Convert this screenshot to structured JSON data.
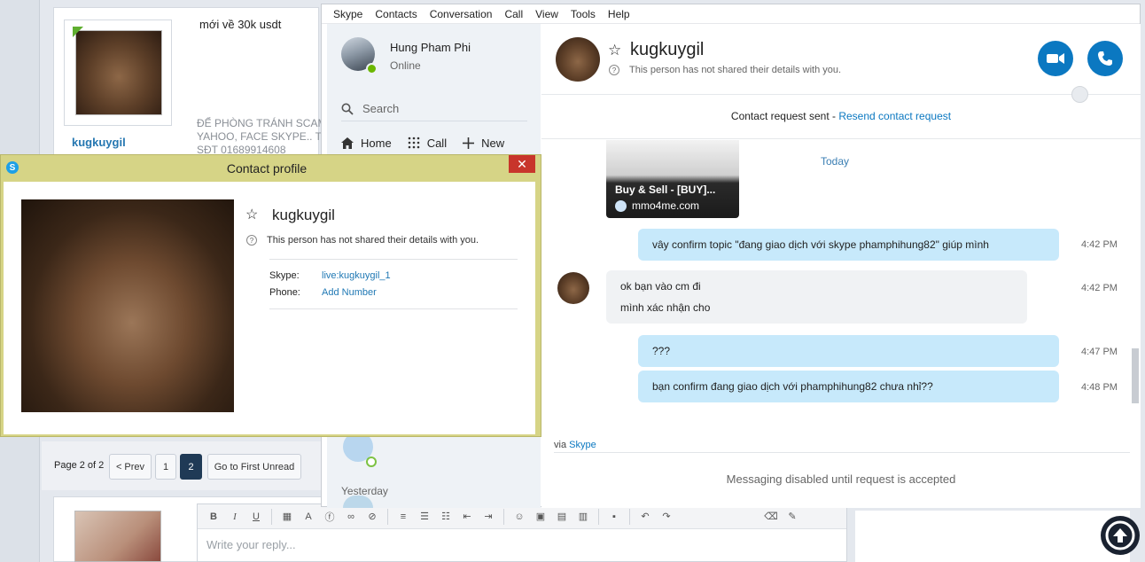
{
  "forum": {
    "post_message": "mới về 30k usdt",
    "warning_lines": [
      "ĐỂ PHÒNG TRÁNH SCAM",
      "YAHOO, FACE SKYPE.. T",
      "SĐT 01689914608"
    ],
    "username": "kugkuygil",
    "pagination": {
      "label": "Page 2 of 2",
      "prev": "< Prev",
      "page1": "1",
      "page2": "2",
      "first_unread": "Go to First Unread"
    },
    "editor": {
      "placeholder": "Write your reply...",
      "bold": "B",
      "italic": "I",
      "underline": "U"
    }
  },
  "skype": {
    "menu": [
      "Skype",
      "Contacts",
      "Conversation",
      "Call",
      "View",
      "Tools",
      "Help"
    ],
    "me": {
      "name": "Hung Pham Phi",
      "status": "Online"
    },
    "search_label": "Search",
    "nav": {
      "home": "Home",
      "call": "Call",
      "new": "New"
    },
    "yesterday": "Yesterday",
    "contact": {
      "name": "kugkuygil",
      "subtitle": "This person has not shared their details with you."
    },
    "request_bar": {
      "text": "Contact request sent - ",
      "link": "Resend contact request"
    },
    "link_card": {
      "title": "Buy & Sell - [BUY]...",
      "domain": "mmo4me.com"
    },
    "today": "Today",
    "messages": [
      {
        "dir": "out",
        "text": "vây confirm topic \"đang giao dịch với skype phamphihung82\" giúp mình",
        "time": "4:42 PM"
      },
      {
        "dir": "in",
        "text": "ok bạn vào cm đi",
        "time": "4:42 PM"
      },
      {
        "dir": "in",
        "text": "mình xác nhận cho",
        "time": ""
      },
      {
        "dir": "out",
        "text": "???",
        "time": "4:47 PM"
      },
      {
        "dir": "out",
        "text": "bạn confirm đang giao dịch với phamphihung82 chưa nhỉ??",
        "time": "4:48 PM"
      }
    ],
    "via_label": "via ",
    "via_link": "Skype",
    "disabled_msg": "Messaging disabled until request is accepted",
    "colors": {
      "accent": "#0b78c1",
      "out_bubble": "#c7e9fb",
      "in_bubble": "#f0f2f4",
      "presence": "#6bb700"
    }
  },
  "dialog": {
    "title": "Contact profile",
    "close": "✕",
    "name": "kugkuygil",
    "subtitle": "This person has not shared their details with you.",
    "skype_key": "Skype:",
    "skype_val": "live:kugkuygil_1",
    "phone_key": "Phone:",
    "phone_val": "Add Number",
    "skype_badge": "S"
  }
}
